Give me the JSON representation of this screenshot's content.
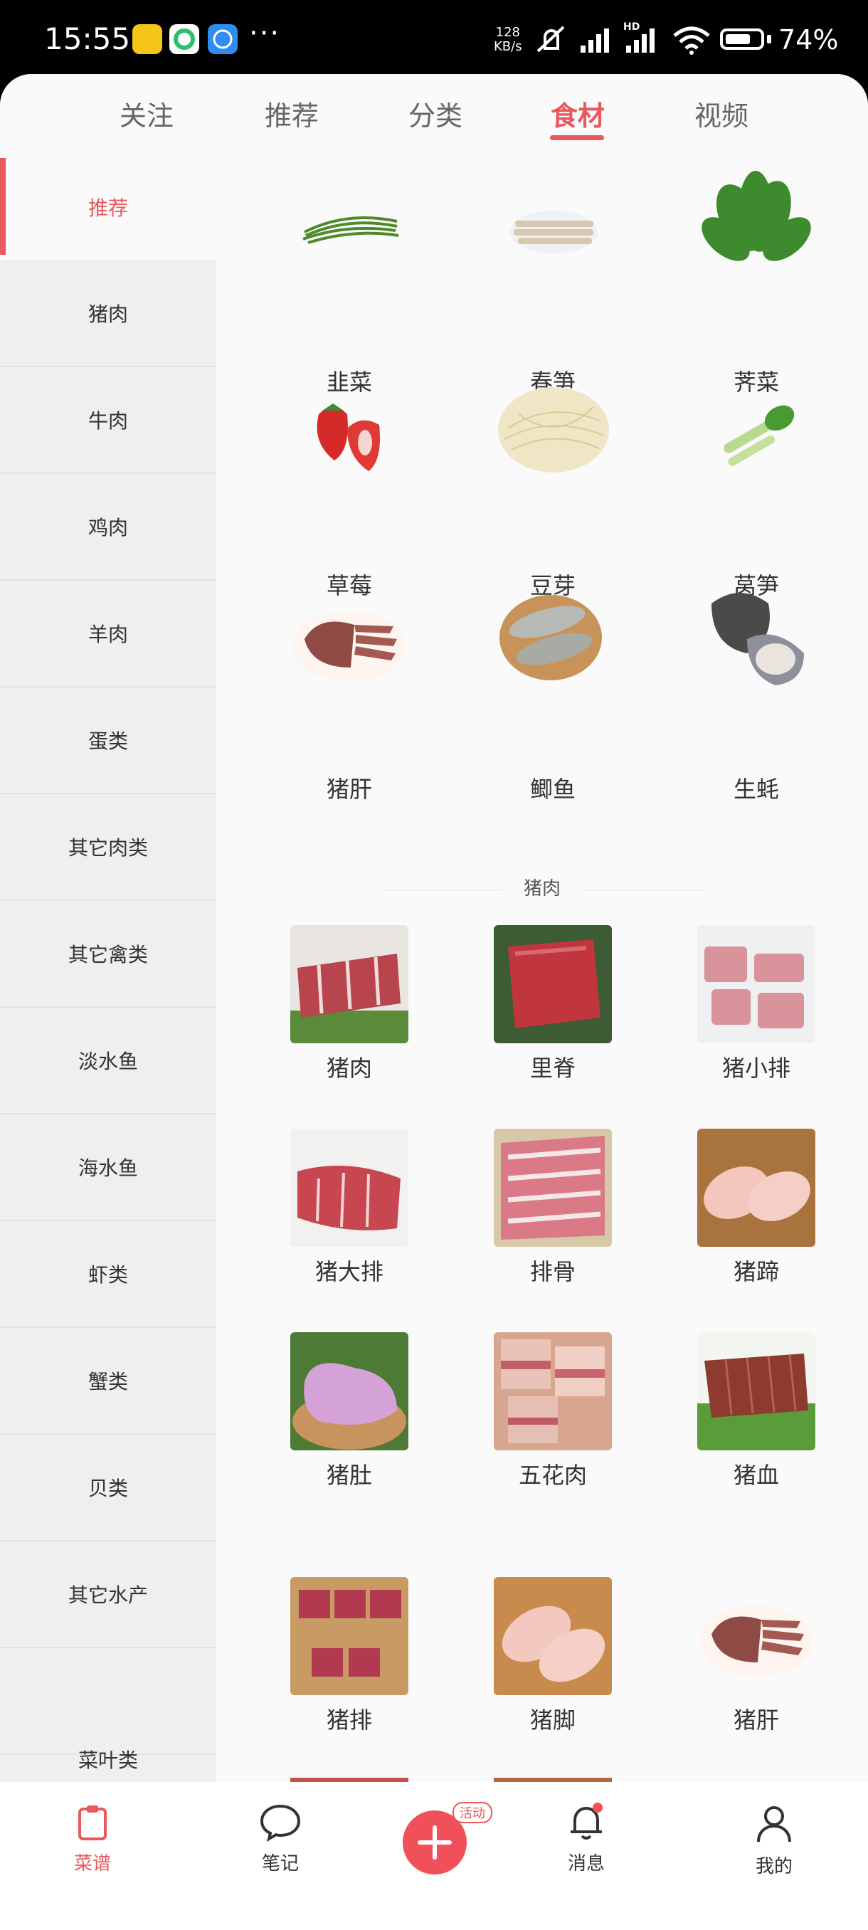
{
  "status": {
    "time": "15:55",
    "net_speed_value": "128",
    "net_speed_unit": "KB/s",
    "battery": "74%",
    "battery_level": 0.74,
    "more": "···",
    "network_type": "HD"
  },
  "tabs": [
    "关注",
    "推荐",
    "分类",
    "食材",
    "视频"
  ],
  "active_tab": "食材",
  "sidebar": {
    "items": [
      "推荐",
      "猪肉",
      "牛肉",
      "鸡肉",
      "羊肉",
      "蛋类",
      "其它肉类",
      "其它禽类",
      "淡水鱼",
      "海水鱼",
      "虾类",
      "蟹类",
      "贝类",
      "其它水产",
      "菜叶类"
    ],
    "active": "推荐"
  },
  "recommend_items": [
    "韭菜",
    "春笋",
    "荠菜",
    "草莓",
    "豆芽",
    "莴笋",
    "猪肝",
    "鲫鱼",
    "生蚝"
  ],
  "pork_section": {
    "title": "猪肉",
    "items": [
      "猪肉",
      "里脊",
      "猪小排",
      "猪大排",
      "排骨",
      "猪蹄",
      "猪肚",
      "五花肉",
      "猪血",
      "猪排",
      "猪脚",
      "猪肝"
    ]
  },
  "bottom_nav": {
    "items": [
      "菜谱",
      "笔记",
      "消息",
      "我的"
    ],
    "activity_badge": "活动"
  },
  "colors": {
    "accent": "#e8585d",
    "plus_button": "#f0505a"
  }
}
